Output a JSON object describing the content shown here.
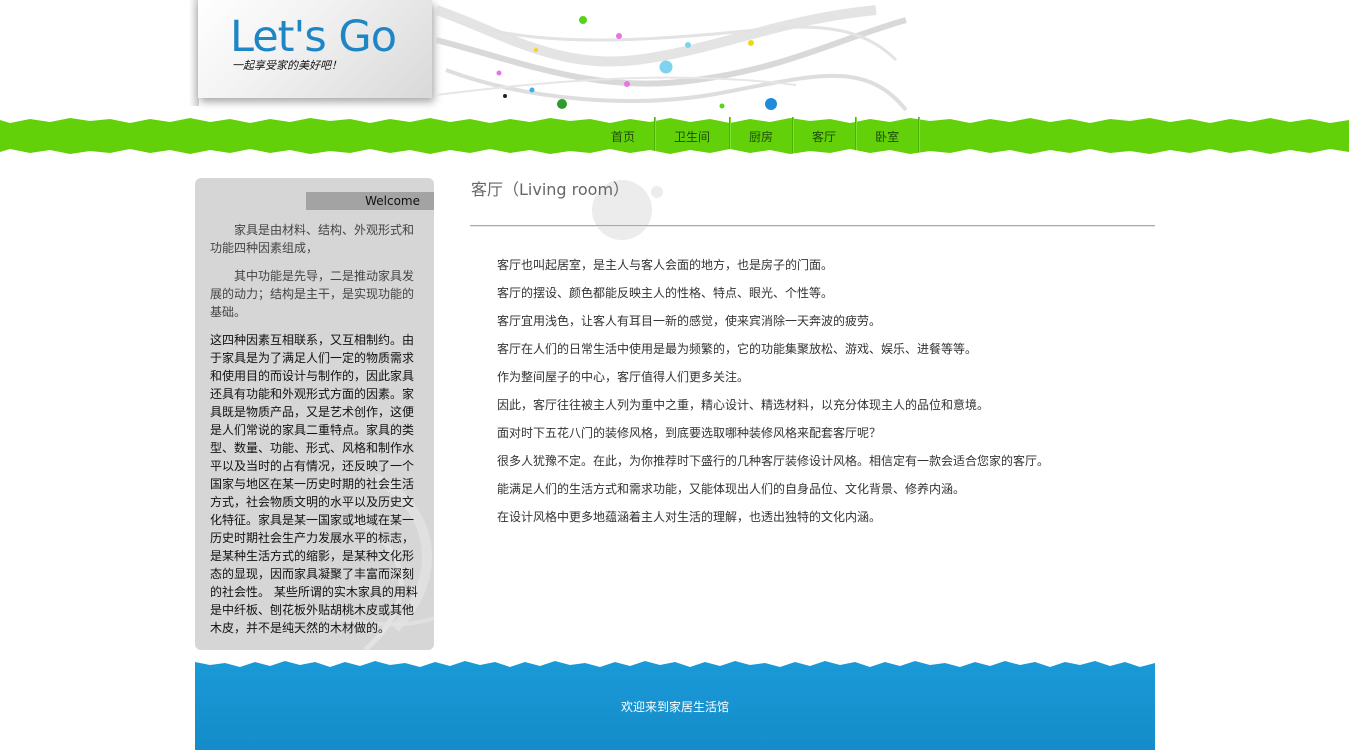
{
  "brand": {
    "title": "Let's Go",
    "slogan": "一起享受家的美好吧！",
    "title_color": "#1f86c6"
  },
  "nav": {
    "items": [
      {
        "label": "首页"
      },
      {
        "label": "卫生间"
      },
      {
        "label": "厨房"
      },
      {
        "label": "客厅"
      },
      {
        "label": "卧室"
      }
    ],
    "bar_color": "#62d10a"
  },
  "sidebar": {
    "welcome": "Welcome",
    "paragraphs": [
      "家具是由材料、结构、外观形式和功能四种因素组成，",
      "其中功能是先导，二是推动家具发展的动力；结构是主干，是实现功能的基础。",
      "这四种因素互相联系，又互相制约。由于家具是为了满足人们一定的物质需求和使用目的而设计与制作的，因此家具还具有功能和外观形式方面的因素。家具既是物质产品，又是艺术创作，这便是人们常说的家具二重特点。家具的类型、数量、功能、形式、风格和制作水平以及当时的占有情况，还反映了一个国家与地区在某一历史时期的社会生活方式，社会物质文明的水平以及历史文化特征。家具是某一国家或地域在某一历史时期社会生产力发展水平的标志，是某种生活方式的缩影，是某种文化形态的显现，因而家具凝聚了丰富而深刻的社会性。 某些所谓的实木家具的用料是中纤板、刨花板外贴胡桃木皮或其他木皮，并不是纯天然的木材做的。"
    ],
    "background_color": "#d6d6d6"
  },
  "main": {
    "title": "客厅（Living room）",
    "lines": [
      "客厅也叫起居室，是主人与客人会面的地方，也是房子的门面。",
      "客厅的摆设、颜色都能反映主人的性格、特点、眼光、个性等。",
      "客厅宜用浅色，让客人有耳目一新的感觉，使来宾消除一天奔波的疲劳。",
      "客厅在人们的日常生活中使用是最为频繁的，它的功能集聚放松、游戏、娱乐、进餐等等。",
      "作为整间屋子的中心，客厅值得人们更多关注。",
      "因此，客厅往往被主人列为重中之重，精心设计、精选材料，以充分体现主人的品位和意境。",
      "面对时下五花八门的装修风格，到底要选取哪种装修风格来配套客厅呢？",
      "很多人犹豫不定。在此，为你推荐时下盛行的几种客厅装修设计风格。相信定有一款会适合您家的客厅。",
      "能满足人们的生活方式和需求功能，又能体现出人们的自身品位、文化背景、修养内涵。",
      "在设计风格中更多地蕴涵着主人对生活的理解，也透出独特的文化内涵。"
    ]
  },
  "footer": {
    "text": "欢迎来到家居生活馆",
    "color": "#1a9ad8"
  }
}
